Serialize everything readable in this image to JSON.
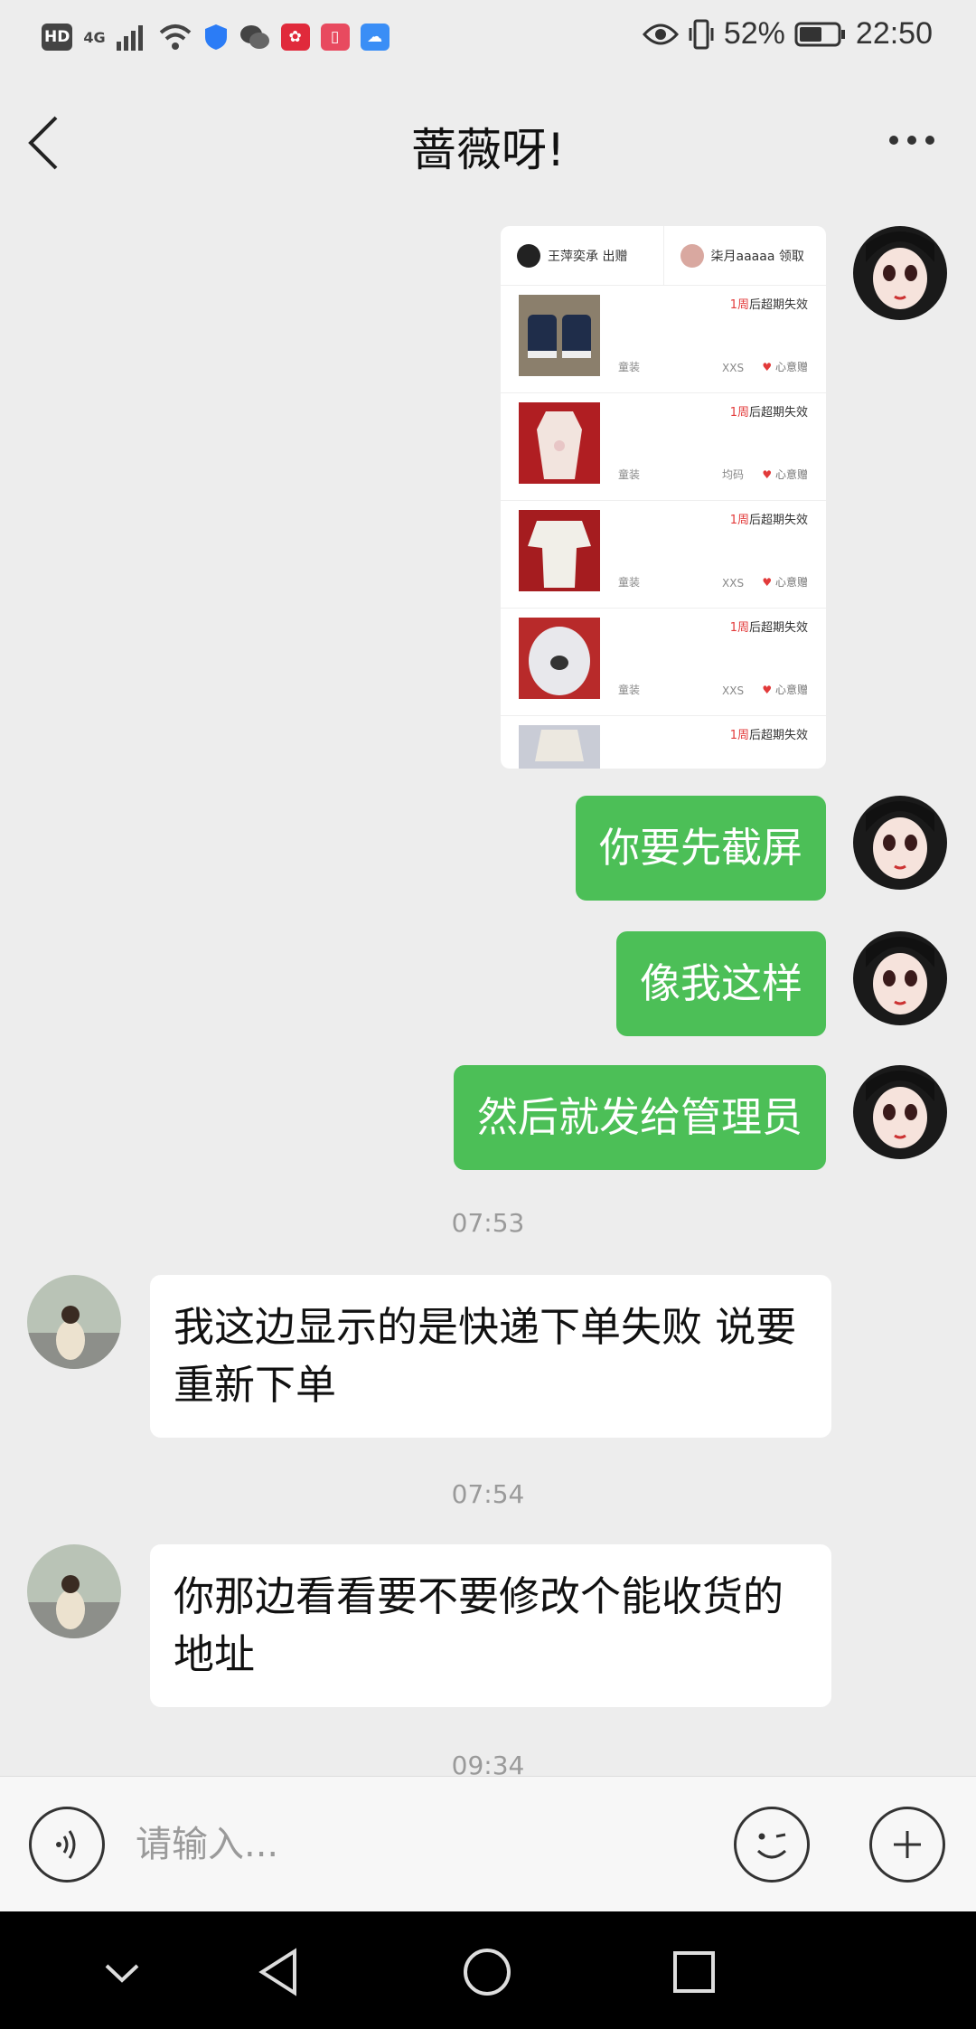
{
  "status_bar": {
    "badges": [
      "HD",
      "4G"
    ],
    "battery": "52%",
    "time": "22:50"
  },
  "header": {
    "title": "蔷薇呀!"
  },
  "shared_card": {
    "left_user": "王萍奕承 出赠",
    "right_user": "柒月aaaaa 领取",
    "items": [
      {
        "expiry_red": "1周",
        "expiry": "后超期失效",
        "tag": "童装",
        "size": "XXS",
        "gift": "心意赠"
      },
      {
        "expiry_red": "1周",
        "expiry": "后超期失效",
        "tag": "童装",
        "size": "均码",
        "gift": "心意赠"
      },
      {
        "expiry_red": "1周",
        "expiry": "后超期失效",
        "tag": "童装",
        "size": "XXS",
        "gift": "心意赠"
      },
      {
        "expiry_red": "1周",
        "expiry": "后超期失效",
        "tag": "童装",
        "size": "XXS",
        "gift": "心意赠"
      },
      {
        "expiry_red": "1周",
        "expiry": "后超期失效"
      }
    ]
  },
  "messages": {
    "m1": "你要先截屏",
    "m2": "像我这样",
    "m3": "然后就发给管理员",
    "t1": "07:53",
    "m4": "我这边显示的是快递下单失败 说要重新下单",
    "t2": "07:54",
    "m5": "你那边看看要不要修改个能收货的地址",
    "t3": "09:34"
  },
  "input": {
    "placeholder": "请输入..."
  },
  "colors": {
    "my_bubble": "#4cbf57",
    "other_bubble": "#ffffff",
    "background": "#ededed",
    "accent_red": "#e23a3a"
  }
}
